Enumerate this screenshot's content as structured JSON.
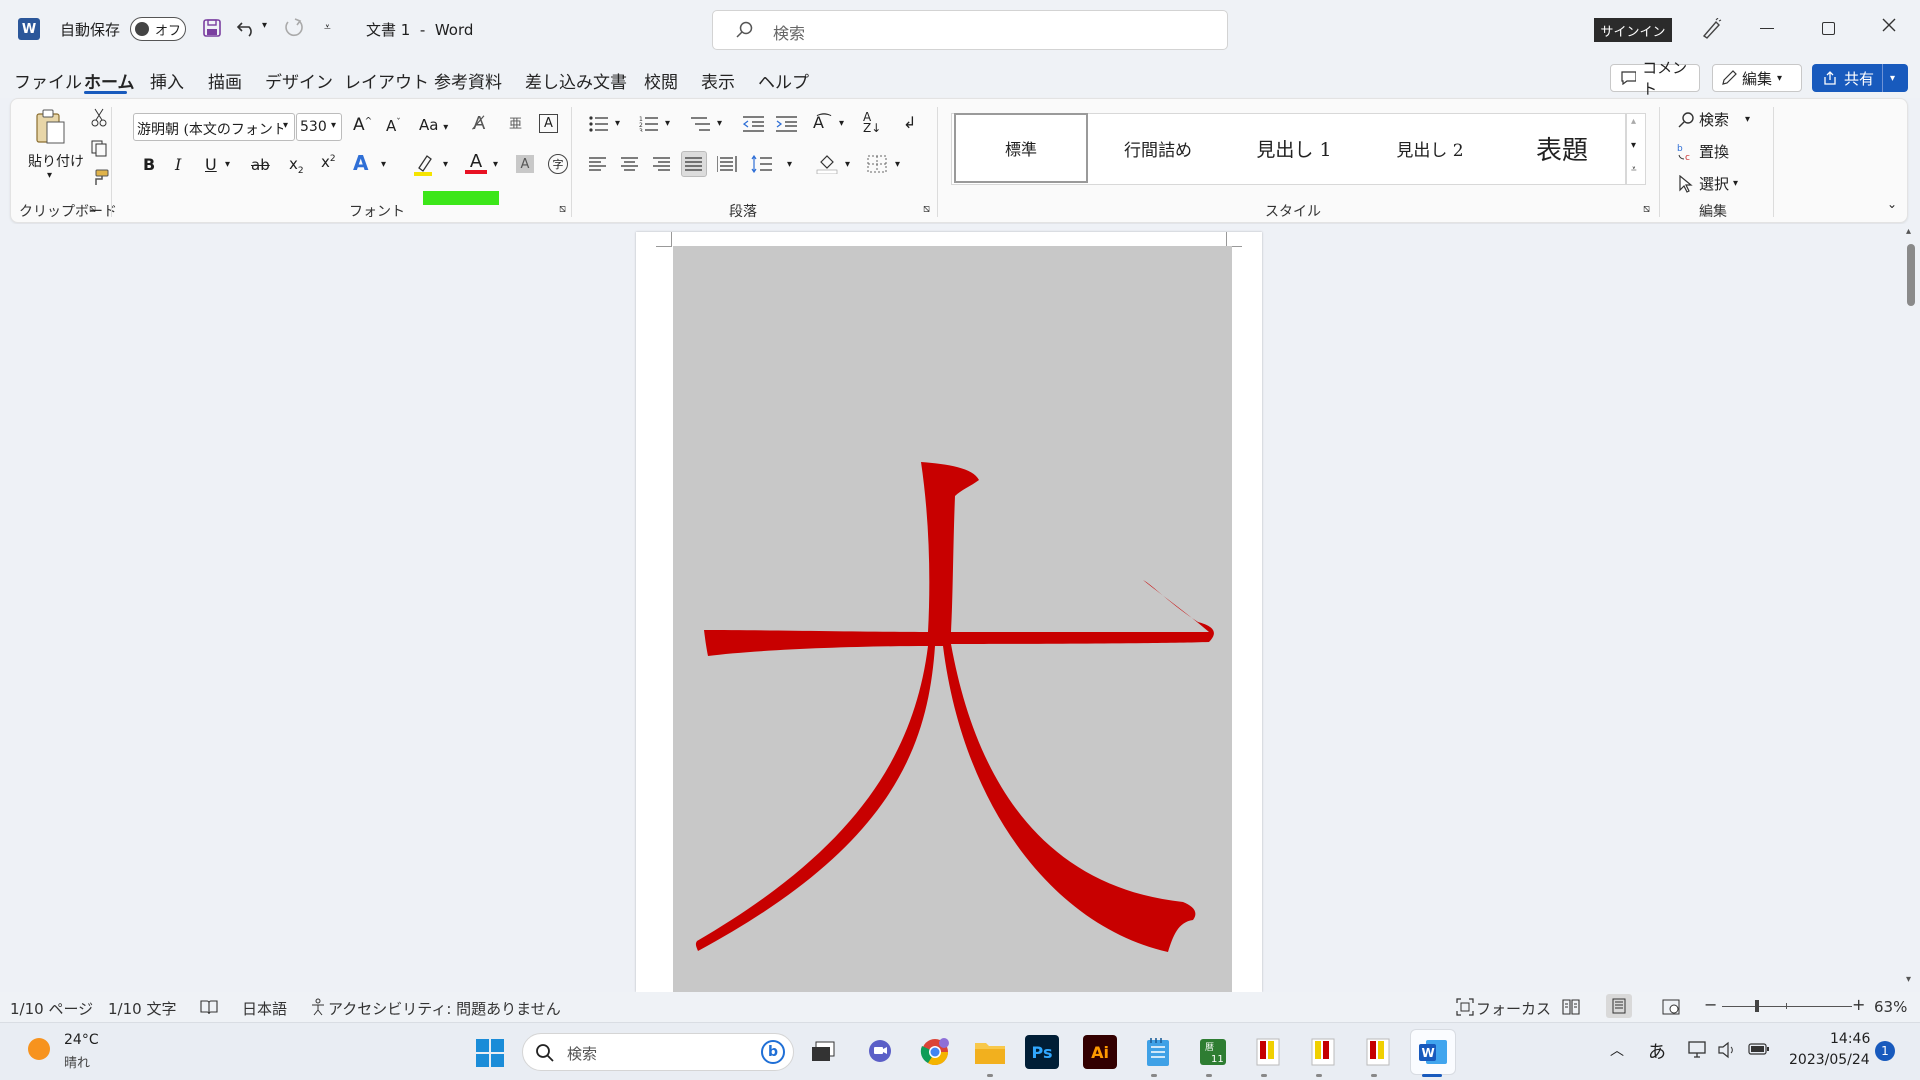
{
  "titlebar": {
    "autosave_label": "自動保存",
    "autosave_state": "オフ",
    "doc_title": "文書 1",
    "separator": "-",
    "app_name": "Word",
    "search_placeholder": "検索",
    "signin": "サインイン"
  },
  "menu": {
    "tabs": [
      "ファイル",
      "ホーム",
      "挿入",
      "描画",
      "デザイン",
      "レイアウト",
      "参考資料",
      "差し込み文書",
      "校閲",
      "表示",
      "ヘルプ"
    ],
    "comment": "コメント",
    "edit": "編集",
    "share": "共有"
  },
  "ribbon": {
    "clipboard": {
      "paste": "貼り付け",
      "label": "クリップボード"
    },
    "font": {
      "font_name": "游明朝 (本文のフォント",
      "font_size": "530",
      "label": "フォント",
      "b": "B",
      "i": "I",
      "u": "U",
      "ab": "ab",
      "aa": "Aa"
    },
    "paragraph": {
      "label": "段落"
    },
    "styles": {
      "items": [
        "標準",
        "行間詰め",
        "見出し 1",
        "見出し 2",
        "表題"
      ],
      "label": "スタイル"
    },
    "editing": {
      "find": "検索",
      "replace": "置換",
      "select": "選択",
      "label": "編集"
    },
    "colors": {
      "highlight": "#3ce619",
      "font_color": "#e81123"
    }
  },
  "document": {
    "character": "大",
    "character_color": "#c80000",
    "shape_fill": "#c8c8c8"
  },
  "statusbar": {
    "page": "1/10 ページ",
    "words": "1/10 文字",
    "language": "日本語",
    "accessibility": "アクセシビリティ: 問題ありません",
    "focus": "フォーカス",
    "zoom": "63%",
    "zoom_minus": "−",
    "zoom_plus": "+"
  },
  "taskbar": {
    "temp": "24°C",
    "weather": "晴れ",
    "search": "検索",
    "ime": "あ",
    "time": "14:46",
    "date": "2023/05/24",
    "notifications": "1"
  }
}
